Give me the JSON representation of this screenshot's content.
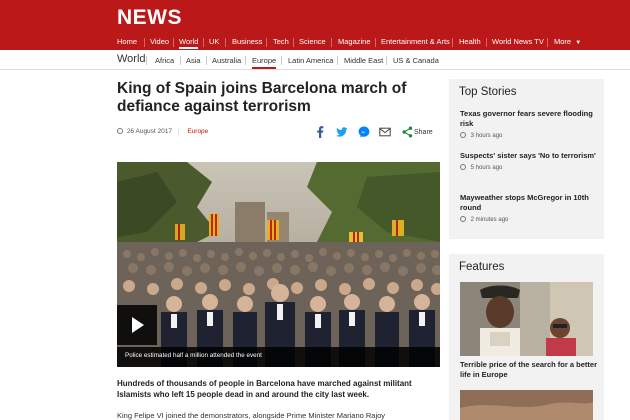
{
  "brand": {
    "logo": "NEWS",
    "color": "#bb1919"
  },
  "main_nav": {
    "items": [
      "Home",
      "Video",
      "World",
      "UK",
      "Business",
      "Tech",
      "Science",
      "Magazine",
      "Entertainment & Arts",
      "Health",
      "World News TV",
      "More"
    ],
    "active": "World",
    "more_icon": "caret-down-icon"
  },
  "sub_nav": {
    "section": "World",
    "items": [
      "Africa",
      "Asia",
      "Australia",
      "Europe",
      "Latin America",
      "Middle East",
      "US & Canada"
    ],
    "active": "Europe"
  },
  "article": {
    "headline": "King of Spain joins Barcelona march of defiance against terrorism",
    "date": "26 August 2017",
    "tag": "Europe",
    "share_label": "Share",
    "share_icons": [
      "facebook-icon",
      "twitter-icon",
      "messenger-icon",
      "email-icon",
      "share-icon"
    ],
    "image_caption": "Police estimated half a million attended the event",
    "intro": "Hundreds of thousands of people in Barcelona have marched against militant Islamists who left 15 people dead in and around the city last week.",
    "paragraph": "King Felipe VI joined the demonstrators, alongside Prime Minister Mariano Rajoy"
  },
  "top_stories": {
    "title": "Top Stories",
    "items": [
      {
        "title": "Texas governor fears severe flooding risk",
        "time": "3 hours ago"
      },
      {
        "title": "Suspects' sister says 'No to terrorism'",
        "time": "5 hours ago"
      },
      {
        "title": "Mayweather stops McGregor in 10th round",
        "time": "2 minutes ago"
      }
    ]
  },
  "features": {
    "title": "Features",
    "items": [
      {
        "title": "Terrible price of the search for a better life in Europe"
      }
    ]
  }
}
